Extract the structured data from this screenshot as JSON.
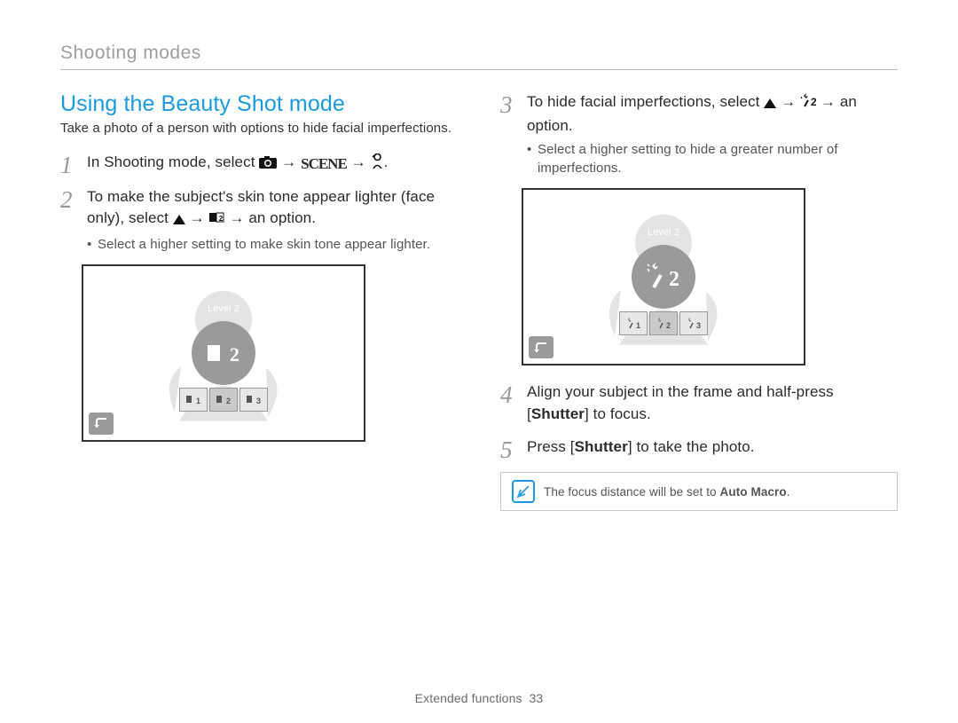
{
  "header": {
    "section": "Shooting modes"
  },
  "topic": {
    "title": "Using the Beauty Shot mode",
    "intro": "Take a photo of a person with options to hide facial imperfections."
  },
  "steps_left": {
    "s1": {
      "prefix": "In Shooting mode, select "
    },
    "s2": {
      "line1": "To make the subject's skin tone appear lighter (face",
      "line2_a": "only), select ",
      "line2_b": " an option.",
      "sub1": "Select a higher setting to make skin tone appear lighter."
    }
  },
  "steps_right": {
    "s3": {
      "line1_a": "To hide facial imperfections, select ",
      "line1_b": " an",
      "line2": "option.",
      "sub1": "Select a higher setting to hide a greater number of imperfections."
    },
    "s4": {
      "text_a": "Align your subject in the frame and half-press [",
      "shutter": "Shutter",
      "text_b": "] to focus."
    },
    "s5": {
      "text_a": "Press [",
      "shutter": "Shutter",
      "text_b": "] to take the photo."
    }
  },
  "screenshot_a": {
    "level_label": "Level 2",
    "icons": [
      "1",
      "2",
      "3"
    ]
  },
  "screenshot_b": {
    "level_label": "Level 2",
    "icons": [
      "1",
      "2",
      "3"
    ]
  },
  "note": {
    "text_a": "The focus distance will be set to ",
    "bold": "Auto Macro",
    "text_b": "."
  },
  "footer": {
    "label": "Extended functions",
    "page": "33"
  }
}
